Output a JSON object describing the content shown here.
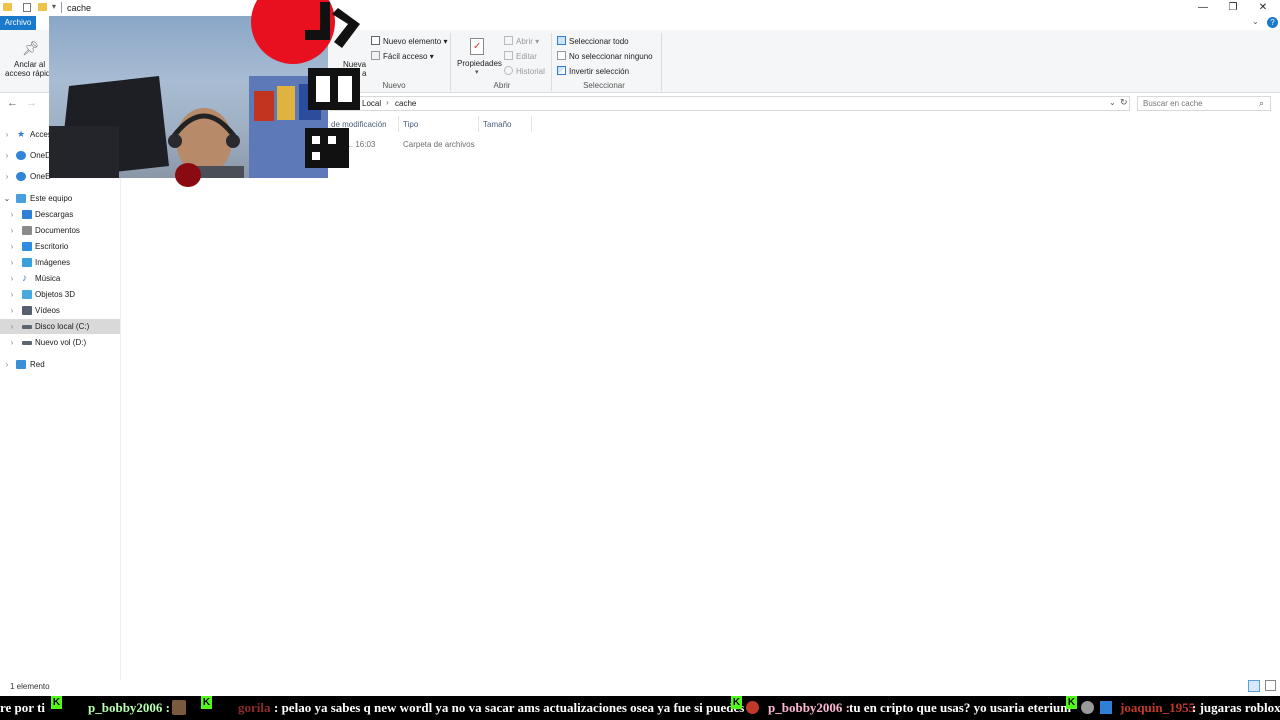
{
  "window": {
    "title": "cache",
    "controls": {
      "minimize": "—",
      "maximize": "❐",
      "close": "✕"
    }
  },
  "ribbon": {
    "tab_file": "Archivo",
    "pin_label_1": "Anclar al",
    "pin_label_2": "acceso rápido",
    "new_folder_1": "Nueva",
    "new_folder_2": "a",
    "new_item": "Nuevo elemento",
    "easy_access": "Fácil acceso",
    "group_new": "Nuevo",
    "properties": "Propiedades",
    "open": "Abrir",
    "edit": "Editar",
    "history": "Historial",
    "group_open": "Abrir",
    "select_all": "Seleccionar todo",
    "select_none": "No seleccionar ninguno",
    "invert_selection": "Invertir selección",
    "group_select": "Seleccionar"
  },
  "address": {
    "crumb_parent": "Local",
    "crumb_current": "cache",
    "search_placeholder": "Buscar en cache"
  },
  "nav": {
    "quick_access": "Acces",
    "onedrive_1": "OneD",
    "onedrive_2": "OneE",
    "this_pc": "Este equipo",
    "items": [
      {
        "label": "Descargas",
        "icon": "download-icon",
        "color": "#2f7fd6"
      },
      {
        "label": "Documentos",
        "icon": "document-icon",
        "color": "#8a8a8a"
      },
      {
        "label": "Escritorio",
        "icon": "desktop-icon",
        "color": "#2d8de3"
      },
      {
        "label": "Imágenes",
        "icon": "pictures-icon",
        "color": "#3aa0dc"
      },
      {
        "label": "Música",
        "icon": "music-icon",
        "color": "#2f7fd6"
      },
      {
        "label": "Objetos 3D",
        "icon": "cube-icon",
        "color": "#47a9e0"
      },
      {
        "label": "Vídeos",
        "icon": "video-icon",
        "color": "#555f6e"
      },
      {
        "label": "Disco local (C:)",
        "icon": "drive-icon",
        "color": "#5c6670"
      },
      {
        "label": "Nuevo vol (D:)",
        "icon": "drive-icon",
        "color": "#5c6670"
      }
    ],
    "network": "Red"
  },
  "columns": {
    "modified": "de modificación",
    "type": "Tipo",
    "size": "Tamaño"
  },
  "rows": [
    {
      "modified": "2... 16:03",
      "type": "Carpeta de archivos"
    }
  ],
  "status": {
    "count": "1 elemento"
  },
  "ticker": {
    "t1": "re por ti",
    "u1": "p_bobby2006 :",
    "u2": "gorila",
    "m2": ":  pelao ya sabes q new wordl ya no va sacar ams actualizaciones osea ya fue   si puedes",
    "u3": "p_bobby2006 :",
    "m3": "tu en cripto que usas? yo usaria eterium",
    "u4": "joaquin_1955",
    "m4": ":  jugaras roblox",
    "badge": "K"
  },
  "colors": {
    "accent": "#1979ca",
    "selection": "#d9d9d9",
    "kick_green": "#53fc18",
    "overlay_red": "#e8101e"
  }
}
